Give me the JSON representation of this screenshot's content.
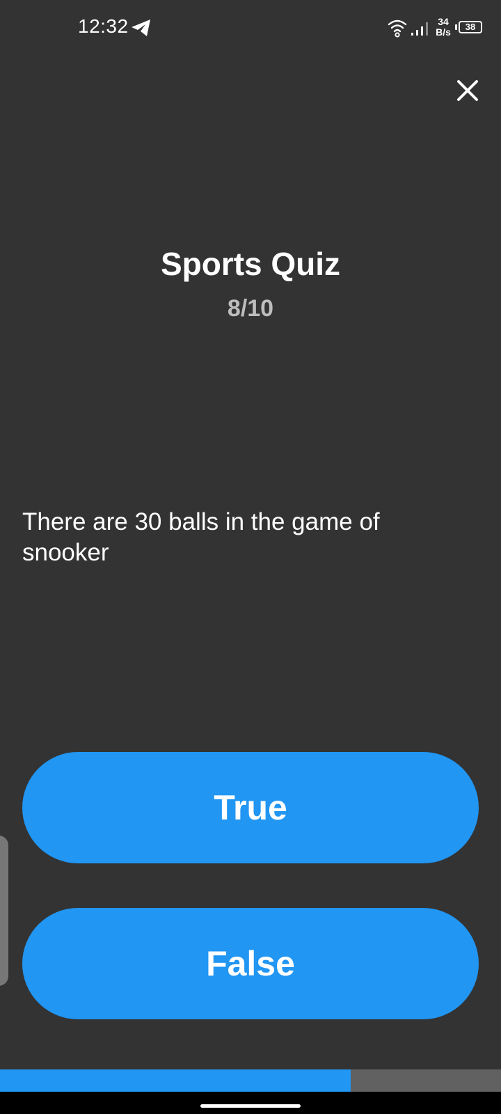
{
  "status_bar": {
    "time": "12:32",
    "net_speed_value": "34",
    "net_speed_unit": "B/s",
    "battery": "38",
    "icons": [
      "telegram-icon",
      "wifi-icon",
      "signal-icon",
      "battery-icon"
    ]
  },
  "header": {
    "close_icon": "close-icon"
  },
  "quiz": {
    "title": "Sports Quiz",
    "progress_text": "8/10",
    "question": "There are 30 balls in the game of snooker",
    "answers": {
      "true_label": "True",
      "false_label": "False"
    },
    "progress_fraction": 0.7
  },
  "colors": {
    "background": "#333333",
    "accent": "#2196f3",
    "progress_track": "#616161",
    "muted_text": "#bdbdbd"
  }
}
